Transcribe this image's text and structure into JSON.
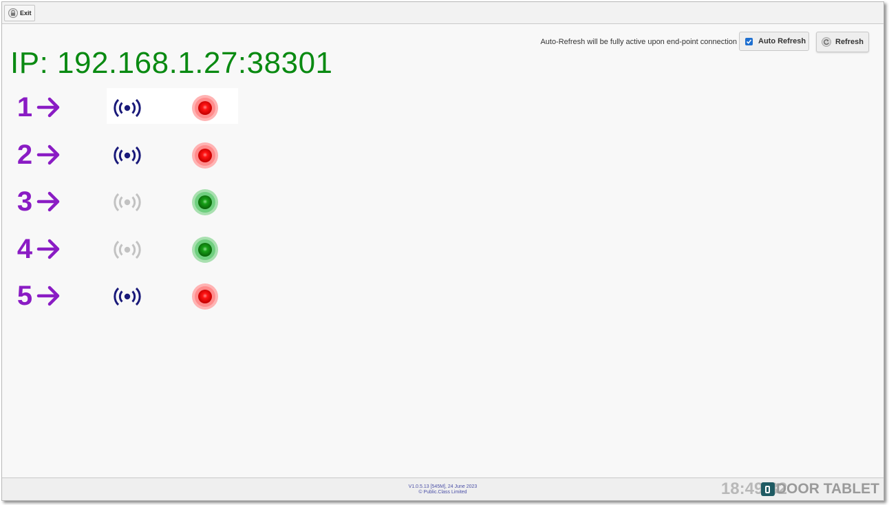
{
  "toolbar": {
    "exit_label": "Exit"
  },
  "header": {
    "autorefresh_note": "Auto-Refresh will be fully active upon end-point connection",
    "auto_refresh_label": "Auto Refresh",
    "auto_refresh_checked": true,
    "refresh_label": "Refresh"
  },
  "main": {
    "ip_text": "IP: 192.168.1.27:38301",
    "devices": [
      {
        "number": "1",
        "signal": "signal-active-icon",
        "status": "red"
      },
      {
        "number": "2",
        "signal": "signal-active-icon",
        "status": "red"
      },
      {
        "number": "3",
        "signal": "signal-inactive-icon",
        "status": "green"
      },
      {
        "number": "4",
        "signal": "signal-inactive-icon",
        "status": "green"
      },
      {
        "number": "5",
        "signal": "signal-active-icon",
        "status": "red"
      }
    ]
  },
  "footer": {
    "version_line1": "V1.0.5.13 [545M], 24 June 2023",
    "version_line2": "© Public.Class Limited",
    "clock": "18:49:32",
    "brand": "DOOR TABLET"
  },
  "colors": {
    "ip_green": "#0a8a12",
    "number_purple": "#8a1cc4",
    "signal_active": "#1a1a7a",
    "signal_inactive": "#c2c2c2",
    "led_red": "#ff1a1a",
    "led_green": "#1aa12a"
  }
}
